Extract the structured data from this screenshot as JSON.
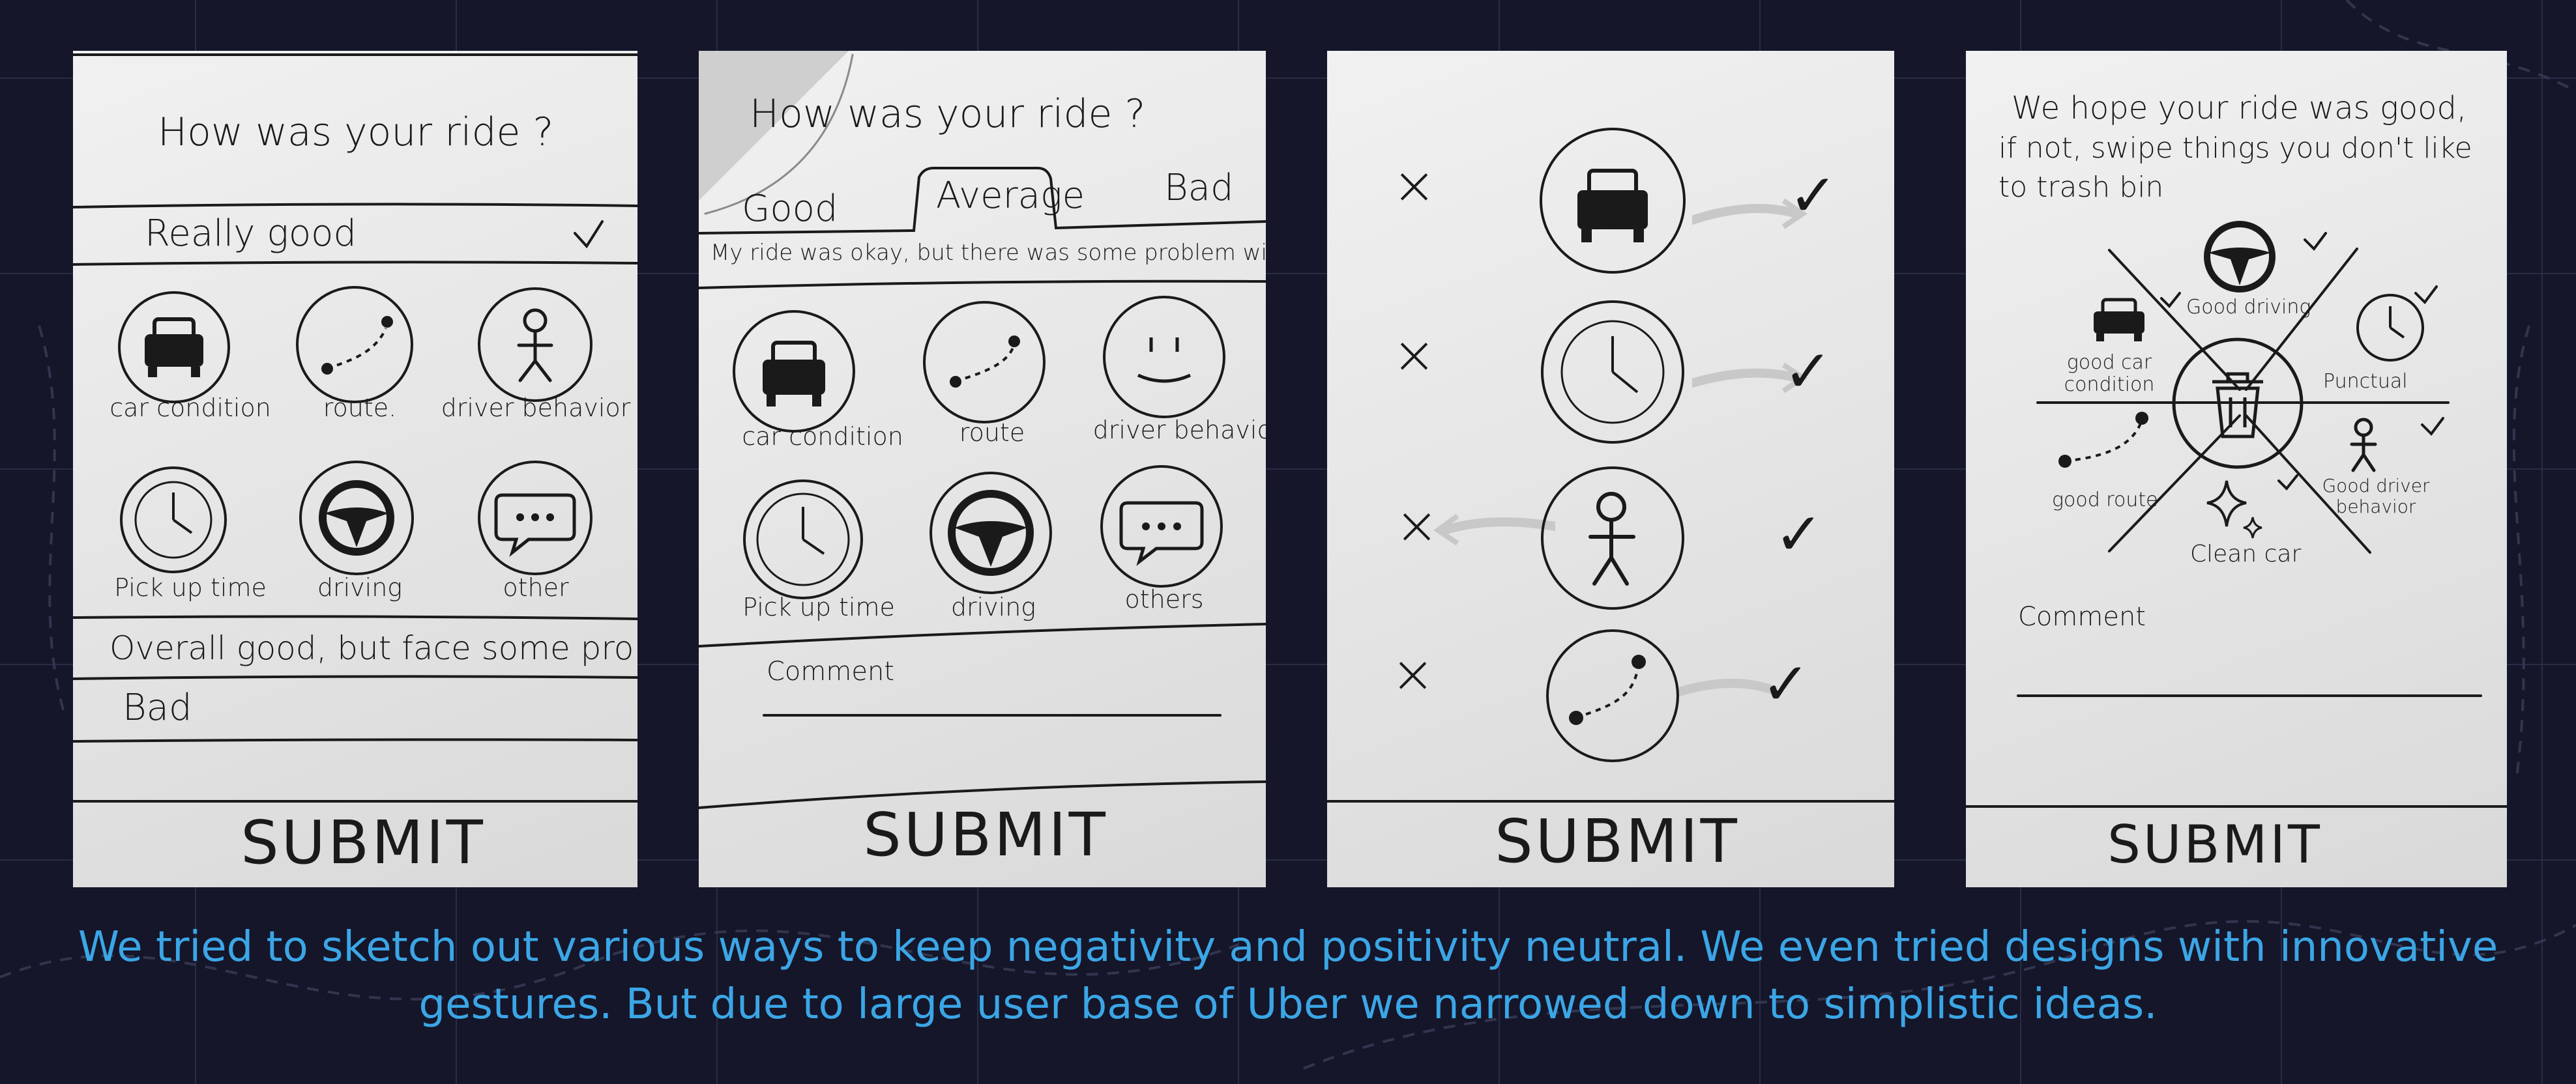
{
  "sketch1": {
    "title": "How was your ride ?",
    "options": [
      "Really good",
      "Overall good, but face some problems",
      "Bad"
    ],
    "icons": [
      {
        "icon": "car-icon",
        "label": "car condition"
      },
      {
        "icon": "route-icon",
        "label": "route."
      },
      {
        "icon": "driver-icon",
        "label": "driver behavior"
      },
      {
        "icon": "clock-icon",
        "label": "Pick up time"
      },
      {
        "icon": "steering-wheel-icon",
        "label": "driving"
      },
      {
        "icon": "chat-bubble-icon",
        "label": "other"
      }
    ],
    "submit": "SUBMIT"
  },
  "sketch2": {
    "title": "How was your ride ?",
    "tabs": [
      "Good",
      "Average",
      "Bad"
    ],
    "message": "My ride was okay, but there was some problem with",
    "icons": [
      {
        "icon": "car-icon",
        "label": "car condition"
      },
      {
        "icon": "route-icon",
        "label": "route"
      },
      {
        "icon": "smiley-icon",
        "label": "driver behavior"
      },
      {
        "icon": "clock-icon",
        "label": "Pick up time"
      },
      {
        "icon": "steering-wheel-icon",
        "label": "driving"
      },
      {
        "icon": "chat-bubble-icon",
        "label": "others"
      }
    ],
    "comment_label": "Comment",
    "submit": "SUBMIT"
  },
  "sketch3": {
    "rows": [
      "car-icon",
      "clock-icon",
      "driver-icon",
      "route-icon"
    ],
    "submit": "SUBMIT"
  },
  "sketch4": {
    "intro_lines": [
      "We hope your ride was good,",
      "if not, swipe things you don't like",
      "to trash bin"
    ],
    "segments": [
      "Good driving",
      "good car condition",
      "Punctual",
      "good route",
      "Good driver behavior",
      "Clean car"
    ],
    "comment_label": "Comment",
    "submit": "SUBMIT"
  },
  "caption": {
    "line1": "We tried to sketch out various ways to keep negativity and positivity neutral. We even tried designs with innovative",
    "line2": "gestures. But due to large user base of Uber we narrowed down to simplistic ideas."
  }
}
